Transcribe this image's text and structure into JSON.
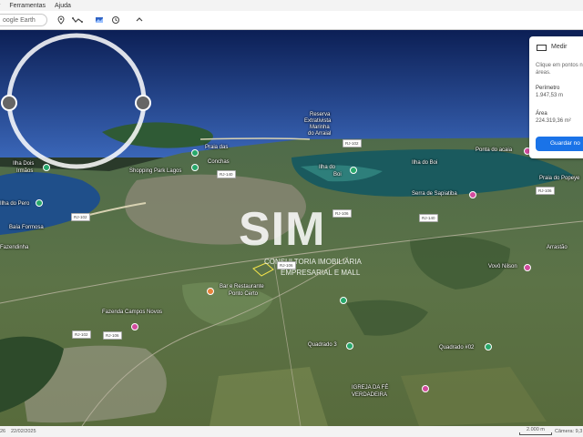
{
  "menu": {
    "items": [
      "r",
      "Ferramentas",
      "Ajuda"
    ]
  },
  "toolbar": {
    "search_placeholder": "oogle Earth"
  },
  "statusbar": {
    "left_text": "26",
    "date": "22/02/2025",
    "scale": "2.000 m",
    "camera": "Câmera: 9,3"
  },
  "measure": {
    "title": "Medir",
    "hint": "Clique em pontos n áreas.",
    "perimeter_label": "Perímetro",
    "perimeter_value": "1.947,53 m",
    "area_label": "Área",
    "area_value": "224.319,36 m²",
    "save_label": "Guardar no"
  },
  "watermark": {
    "text": "SIM",
    "sub1": "CONSULTORIA IMOBILIÁRIA",
    "sub2": "EMPRESARIAL E MALL"
  },
  "places": {
    "reserva1": "Reserva",
    "reserva2": "Extrativista",
    "reserva3": "Marinha",
    "reserva4": "do Arraial",
    "praia_das": "Praia das",
    "conchas": "Conchas",
    "shopping": "Shopping Park Lagos",
    "ilha_dois1": "Ilha Dois",
    "ilha_dois2": "Irmãos",
    "ilha_do_boi": "Ilha do Boi",
    "serra": "Serra de Sapiatiba",
    "praia_peroba": "Praia do Popeye",
    "ponta_acaia": "Ponta do acaia",
    "baia_formosa": "Baía Formosa",
    "fazendinha": "Fazendinha",
    "ilha_pero": "Ilha do Pero",
    "bar_rest1": "Bar e Restaurante",
    "bar_rest2": "Ponto Certo",
    "fazenda": "Fazenda Campos Novos",
    "quadrado3": "Quadrado 3",
    "quadrado2": "Quadrado #02",
    "igreja1": "IGREJA DA FÉ",
    "igreja2": "VERDADEIRA",
    "arrastao": "Arrastão",
    "vovo": "Vovô Nilson",
    "ilha_boi2": "Ilha do",
    "ilha_boi3": "Boi"
  },
  "roads": {
    "rj102a": "RJ-102",
    "rj140a": "RJ-140",
    "rj102b": "RJ-102",
    "rj106a": "RJ-106",
    "rj140b": "RJ-140",
    "rj106b": "RJ-106",
    "rj102c": "RJ-102",
    "rj106c": "RJ-106",
    "rj106d": "RJ-106"
  }
}
